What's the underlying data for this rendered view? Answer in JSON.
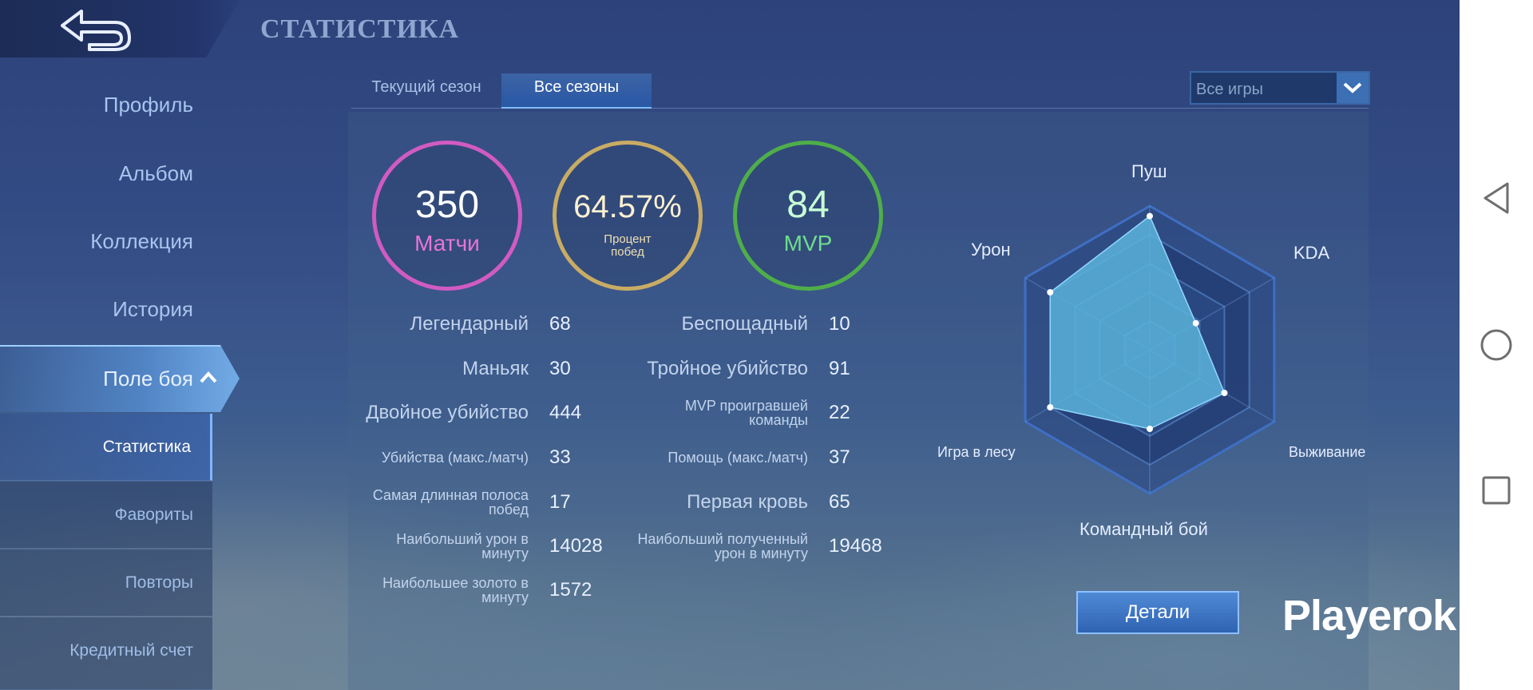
{
  "header": {
    "title": "СТАТИСТИКА",
    "back_icon": "back-arrow-icon"
  },
  "sidebar": {
    "items": [
      {
        "label": "Профиль"
      },
      {
        "label": "Альбом"
      },
      {
        "label": "Коллекция"
      },
      {
        "label": "История"
      }
    ],
    "active": {
      "label": "Поле боя"
    },
    "sub_items": [
      {
        "label": "Статистика"
      },
      {
        "label": "Фавориты"
      },
      {
        "label": "Повторы"
      },
      {
        "label": "Кредитный счет"
      }
    ]
  },
  "tabs": {
    "current": "Текущий сезон",
    "all": "Все сезоны"
  },
  "filter": {
    "value": "Все игры"
  },
  "summary": {
    "matches": {
      "value": "350",
      "label": "Матчи",
      "color": "#d15bc2"
    },
    "winrate": {
      "value": "64.57%",
      "label_line1": "Процент",
      "label_line2": "побед",
      "color": "#c9ac64"
    },
    "mvp": {
      "value": "84",
      "label": "MVP",
      "color": "#4fae4a"
    }
  },
  "stats_left": [
    {
      "label": "Легендарный",
      "value": "68"
    },
    {
      "label": "Маньяк",
      "value": "30"
    },
    {
      "label": "Двойное убийство",
      "value": "444"
    },
    {
      "label": "Убийства (макс./матч)",
      "value": "33"
    },
    {
      "label": "Самая длинная полоса побед",
      "value": "17"
    },
    {
      "label": "Наибольший урон в минуту",
      "value": "14028"
    },
    {
      "label": "Наибольшее золото в минуту",
      "value": "1572"
    }
  ],
  "stats_right": [
    {
      "label": "Беспощадный",
      "value": "10"
    },
    {
      "label": "Тройное убийство",
      "value": "91"
    },
    {
      "label": "MVP проигравшей команды",
      "value": "22"
    },
    {
      "label": "Помощь (макс./матч)",
      "value": "37"
    },
    {
      "label": "Первая кровь",
      "value": "65"
    },
    {
      "label": "Наибольший полученный урон в минуту",
      "value": "19468"
    }
  ],
  "radar": {
    "axes": [
      "Пуш",
      "KDA",
      "Выживание",
      "Командный бой",
      "Игра в лесу",
      "Урон"
    ],
    "values": [
      0.93,
      0.37,
      0.6,
      0.55,
      0.8,
      0.8
    ],
    "fill_color": "#5ab4dc"
  },
  "details_button": "Детали",
  "watermark": "Playerok",
  "nav": {
    "back": "back-triangle-icon",
    "home": "home-circle-icon",
    "recents": "recents-square-icon"
  }
}
